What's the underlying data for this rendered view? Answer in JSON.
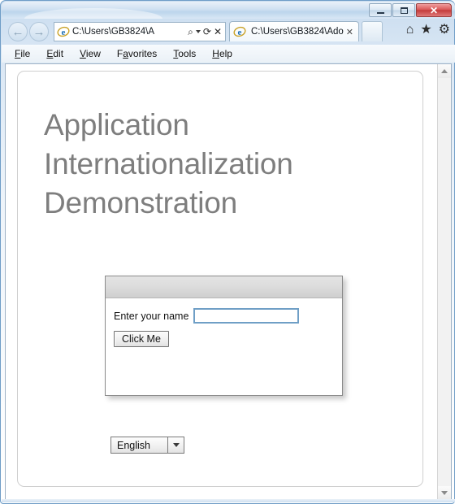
{
  "window": {
    "controls": {
      "minimize": "minimize-button",
      "maximize": "maximize-button",
      "close_label": "✕"
    }
  },
  "navigation": {
    "back_glyph": "←",
    "forward_glyph": "→",
    "address_value": "C:\\Users\\GB3824\\A",
    "address_placeholder": "",
    "search_icon": "⌕",
    "refresh_icon": "⟳",
    "stop_icon": "✕",
    "home_icon": "⌂",
    "favorites_icon": "★",
    "tools_icon": "⚙"
  },
  "tabs": [
    {
      "title": "C:\\Users\\GB3824\\Ado...",
      "close_label": "✕"
    }
  ],
  "menubar": {
    "items": [
      {
        "accel": "F",
        "rest": "ile"
      },
      {
        "accel": "E",
        "rest": "dit"
      },
      {
        "accel": "V",
        "rest": "iew"
      },
      {
        "pre": "F",
        "accel": "a",
        "rest": "vorites"
      },
      {
        "accel": "T",
        "rest": "ools"
      },
      {
        "accel": "H",
        "rest": "elp"
      }
    ]
  },
  "page": {
    "heading": "Application Internationalization Demonstration",
    "heading_color": "#7e7e7e"
  },
  "form": {
    "name_label": "Enter your name",
    "name_value": "",
    "name_placeholder": "",
    "submit_label": "Click Me"
  },
  "language_select": {
    "selected": "English",
    "options": [
      "English"
    ]
  },
  "scrollbar": {
    "up_arrow": "up-arrow",
    "down_arrow": "down-arrow"
  }
}
